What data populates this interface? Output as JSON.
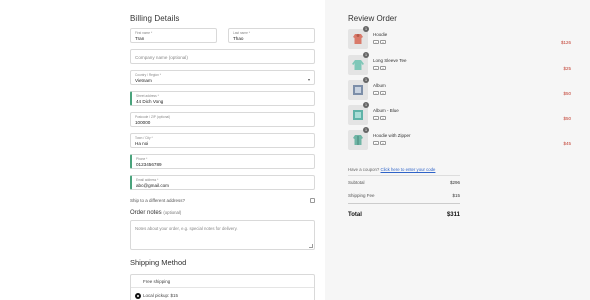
{
  "billing": {
    "heading": "Billing Details",
    "first_name": {
      "label": "First name *",
      "value": "Tran"
    },
    "last_name": {
      "label": "Last name *",
      "value": "Thao"
    },
    "company": {
      "placeholder": "Company name (optional)"
    },
    "country": {
      "label": "Country / Region *",
      "value": "Vietnam"
    },
    "street": {
      "label": "Street address *",
      "value": "44 Dich Vong"
    },
    "postcode": {
      "label": "Postcode / ZIP (optional)",
      "value": "100000"
    },
    "city": {
      "label": "Town / City *",
      "value": "Ha noi"
    },
    "phone": {
      "label": "Phone *",
      "value": "0123456789"
    },
    "email": {
      "label": "Email address *",
      "value": "abc@gmail.com"
    },
    "ship_different": "Ship to a different address?",
    "order_notes": {
      "label": "Order notes",
      "optional": "(optional)",
      "placeholder": "Notes about your order, e.g. special notes for delivery."
    }
  },
  "shipping": {
    "heading": "Shipping Method",
    "options": [
      {
        "label": "Free shipping"
      },
      {
        "label": "Local pickup: $15"
      }
    ]
  },
  "review": {
    "heading": "Review Order",
    "items": [
      {
        "name": "Hoodie",
        "qty": "1",
        "price": "$126",
        "icon": "hoodie-icon"
      },
      {
        "name": "Long Sleeve Tee",
        "qty": "1",
        "price": "$25",
        "icon": "long-sleeve-tee-icon"
      },
      {
        "name": "Album",
        "qty": "1",
        "price": "$50",
        "icon": "album-icon"
      },
      {
        "name": "Album - Blue",
        "qty": "1",
        "price": "$50",
        "icon": "album-blue-icon"
      },
      {
        "name": "Hoodie with Zipper",
        "qty": "1",
        "price": "$45",
        "icon": "hoodie-zipper-icon"
      }
    ],
    "coupon_text": "Have a coupon?",
    "coupon_link": "Click here to enter your code",
    "subtotal_label": "Subtotal",
    "subtotal_value": "$296",
    "shipping_label": "Shipping Fee",
    "shipping_value": "$15",
    "total_label": "Total",
    "total_value": "$311"
  },
  "colors": {
    "accent": "#4aa37c",
    "price": "#c0392b",
    "link": "#2e63c8",
    "panel": "#f6f6f6"
  }
}
